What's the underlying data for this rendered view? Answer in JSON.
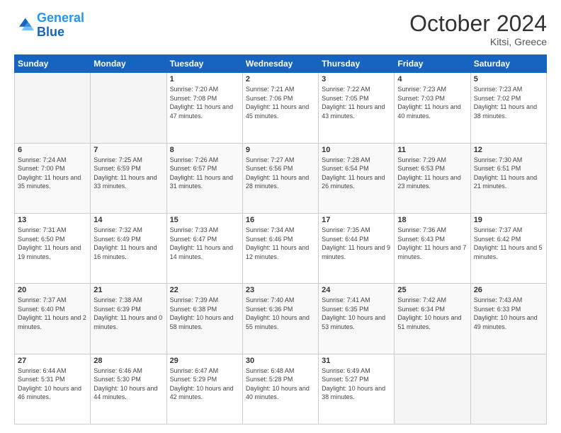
{
  "logo": {
    "line1": "General",
    "line2": "Blue"
  },
  "header": {
    "month": "October 2024",
    "location": "Kitsi, Greece"
  },
  "weekdays": [
    "Sunday",
    "Monday",
    "Tuesday",
    "Wednesday",
    "Thursday",
    "Friday",
    "Saturday"
  ],
  "weeks": [
    [
      {
        "day": "",
        "info": ""
      },
      {
        "day": "",
        "info": ""
      },
      {
        "day": "1",
        "info": "Sunrise: 7:20 AM\nSunset: 7:08 PM\nDaylight: 11 hours and 47 minutes."
      },
      {
        "day": "2",
        "info": "Sunrise: 7:21 AM\nSunset: 7:06 PM\nDaylight: 11 hours and 45 minutes."
      },
      {
        "day": "3",
        "info": "Sunrise: 7:22 AM\nSunset: 7:05 PM\nDaylight: 11 hours and 43 minutes."
      },
      {
        "day": "4",
        "info": "Sunrise: 7:23 AM\nSunset: 7:03 PM\nDaylight: 11 hours and 40 minutes."
      },
      {
        "day": "5",
        "info": "Sunrise: 7:23 AM\nSunset: 7:02 PM\nDaylight: 11 hours and 38 minutes."
      }
    ],
    [
      {
        "day": "6",
        "info": "Sunrise: 7:24 AM\nSunset: 7:00 PM\nDaylight: 11 hours and 35 minutes."
      },
      {
        "day": "7",
        "info": "Sunrise: 7:25 AM\nSunset: 6:59 PM\nDaylight: 11 hours and 33 minutes."
      },
      {
        "day": "8",
        "info": "Sunrise: 7:26 AM\nSunset: 6:57 PM\nDaylight: 11 hours and 31 minutes."
      },
      {
        "day": "9",
        "info": "Sunrise: 7:27 AM\nSunset: 6:56 PM\nDaylight: 11 hours and 28 minutes."
      },
      {
        "day": "10",
        "info": "Sunrise: 7:28 AM\nSunset: 6:54 PM\nDaylight: 11 hours and 26 minutes."
      },
      {
        "day": "11",
        "info": "Sunrise: 7:29 AM\nSunset: 6:53 PM\nDaylight: 11 hours and 23 minutes."
      },
      {
        "day": "12",
        "info": "Sunrise: 7:30 AM\nSunset: 6:51 PM\nDaylight: 11 hours and 21 minutes."
      }
    ],
    [
      {
        "day": "13",
        "info": "Sunrise: 7:31 AM\nSunset: 6:50 PM\nDaylight: 11 hours and 19 minutes."
      },
      {
        "day": "14",
        "info": "Sunrise: 7:32 AM\nSunset: 6:49 PM\nDaylight: 11 hours and 16 minutes."
      },
      {
        "day": "15",
        "info": "Sunrise: 7:33 AM\nSunset: 6:47 PM\nDaylight: 11 hours and 14 minutes."
      },
      {
        "day": "16",
        "info": "Sunrise: 7:34 AM\nSunset: 6:46 PM\nDaylight: 11 hours and 12 minutes."
      },
      {
        "day": "17",
        "info": "Sunrise: 7:35 AM\nSunset: 6:44 PM\nDaylight: 11 hours and 9 minutes."
      },
      {
        "day": "18",
        "info": "Sunrise: 7:36 AM\nSunset: 6:43 PM\nDaylight: 11 hours and 7 minutes."
      },
      {
        "day": "19",
        "info": "Sunrise: 7:37 AM\nSunset: 6:42 PM\nDaylight: 11 hours and 5 minutes."
      }
    ],
    [
      {
        "day": "20",
        "info": "Sunrise: 7:37 AM\nSunset: 6:40 PM\nDaylight: 11 hours and 2 minutes."
      },
      {
        "day": "21",
        "info": "Sunrise: 7:38 AM\nSunset: 6:39 PM\nDaylight: 11 hours and 0 minutes."
      },
      {
        "day": "22",
        "info": "Sunrise: 7:39 AM\nSunset: 6:38 PM\nDaylight: 10 hours and 58 minutes."
      },
      {
        "day": "23",
        "info": "Sunrise: 7:40 AM\nSunset: 6:36 PM\nDaylight: 10 hours and 55 minutes."
      },
      {
        "day": "24",
        "info": "Sunrise: 7:41 AM\nSunset: 6:35 PM\nDaylight: 10 hours and 53 minutes."
      },
      {
        "day": "25",
        "info": "Sunrise: 7:42 AM\nSunset: 6:34 PM\nDaylight: 10 hours and 51 minutes."
      },
      {
        "day": "26",
        "info": "Sunrise: 7:43 AM\nSunset: 6:33 PM\nDaylight: 10 hours and 49 minutes."
      }
    ],
    [
      {
        "day": "27",
        "info": "Sunrise: 6:44 AM\nSunset: 5:31 PM\nDaylight: 10 hours and 46 minutes."
      },
      {
        "day": "28",
        "info": "Sunrise: 6:46 AM\nSunset: 5:30 PM\nDaylight: 10 hours and 44 minutes."
      },
      {
        "day": "29",
        "info": "Sunrise: 6:47 AM\nSunset: 5:29 PM\nDaylight: 10 hours and 42 minutes."
      },
      {
        "day": "30",
        "info": "Sunrise: 6:48 AM\nSunset: 5:28 PM\nDaylight: 10 hours and 40 minutes."
      },
      {
        "day": "31",
        "info": "Sunrise: 6:49 AM\nSunset: 5:27 PM\nDaylight: 10 hours and 38 minutes."
      },
      {
        "day": "",
        "info": ""
      },
      {
        "day": "",
        "info": ""
      }
    ]
  ]
}
